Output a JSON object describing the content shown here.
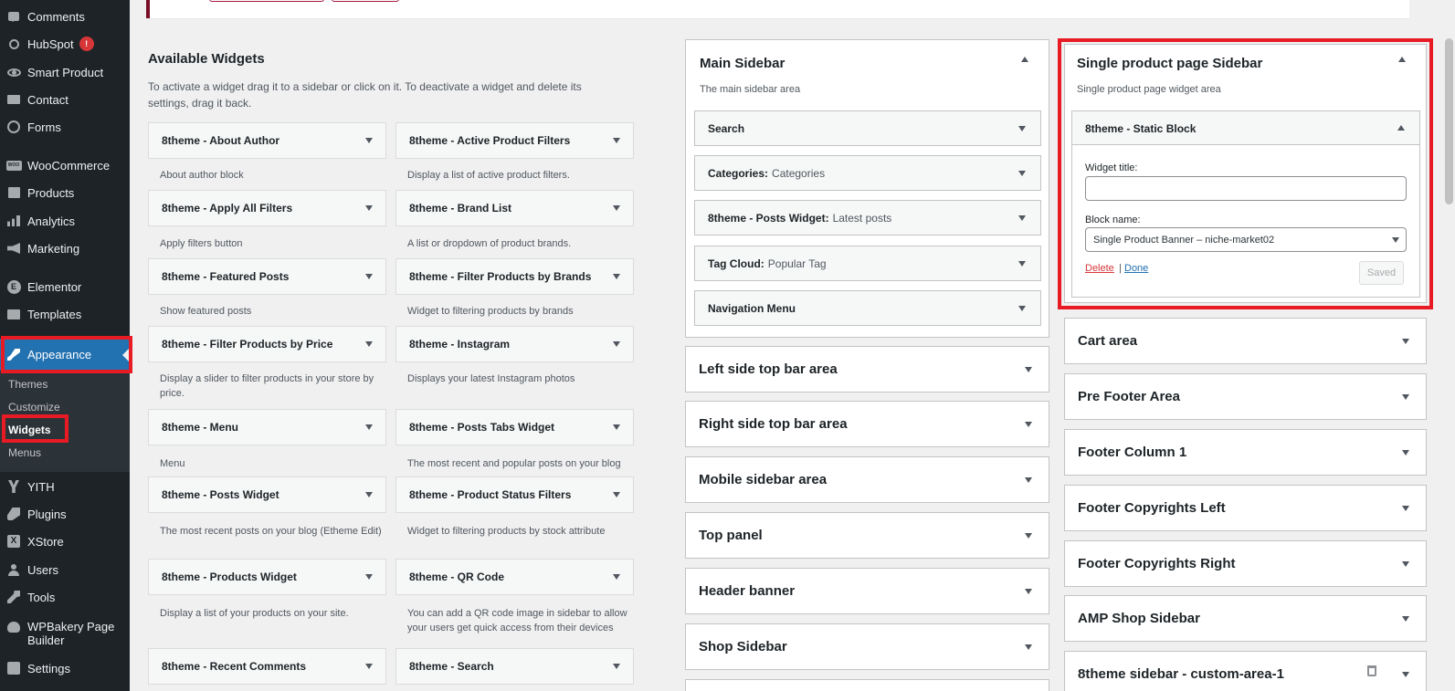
{
  "menu": {
    "items": [
      {
        "label": "Comments",
        "icon": "comments-icon"
      },
      {
        "label": "HubSpot",
        "icon": "hubspot-icon",
        "badge": "!"
      },
      {
        "label": "Smart Product",
        "icon": "eye-icon"
      },
      {
        "label": "Contact",
        "icon": "mail-icon"
      },
      {
        "label": "Forms",
        "icon": "forms-icon"
      },
      {
        "label": "WooCommerce",
        "icon": "woocommerce-icon",
        "icon_text": "WOO"
      },
      {
        "label": "Products",
        "icon": "box-icon"
      },
      {
        "label": "Analytics",
        "icon": "bar-chart-icon"
      },
      {
        "label": "Marketing",
        "icon": "megaphone-icon"
      },
      {
        "label": "Elementor",
        "icon": "elementor-icon",
        "icon_text": "E"
      },
      {
        "label": "Templates",
        "icon": "folder-icon"
      },
      {
        "label": "Appearance",
        "icon": "brush-icon"
      },
      {
        "label": "YITH",
        "icon": "yith-icon"
      },
      {
        "label": "Plugins",
        "icon": "plugin-icon"
      },
      {
        "label": "XStore",
        "icon": "xstore-icon",
        "icon_text": "X"
      },
      {
        "label": "Users",
        "icon": "user-icon"
      },
      {
        "label": "Tools",
        "icon": "wrench-icon"
      },
      {
        "label": "WPBakery Page Builder",
        "icon": "wpbakery-icon"
      },
      {
        "label": "Settings",
        "icon": "settings-icon"
      }
    ],
    "submenu": [
      "Themes",
      "Customize",
      "Widgets",
      "Menus"
    ]
  },
  "available": {
    "title": "Available Widgets",
    "description": "To activate a widget drag it to a sidebar or click on it. To deactivate a widget and delete its settings, drag it back.",
    "widgets": [
      {
        "name": "8theme - About Author",
        "desc": "About author block"
      },
      {
        "name": "8theme - Active Product Filters",
        "desc": "Display a list of active product filters."
      },
      {
        "name": "8theme - Apply All Filters",
        "desc": "Apply filters button"
      },
      {
        "name": "8theme - Brand List",
        "desc": "A list or dropdown of product brands."
      },
      {
        "name": "8theme - Featured Posts",
        "desc": "Show featured posts"
      },
      {
        "name": "8theme - Filter Products by Brands",
        "desc": "Widget to filtering products by brands"
      },
      {
        "name": "8theme - Filter Products by Price",
        "desc": "Display a slider to filter products in your store by price."
      },
      {
        "name": "8theme - Instagram",
        "desc": "Displays your latest Instagram photos"
      },
      {
        "name": "8theme - Menu",
        "desc": "Menu"
      },
      {
        "name": "8theme - Posts Tabs Widget",
        "desc": "The most recent and popular posts on your blog"
      },
      {
        "name": "8theme - Posts Widget",
        "desc": "The most recent posts on your blog (Etheme Edit)"
      },
      {
        "name": "8theme - Product Status Filters",
        "desc": "Widget to filtering products by stock attribute"
      },
      {
        "name": "8theme - Products Widget",
        "desc": "Display a list of your products on your site."
      },
      {
        "name": "8theme - QR Code",
        "desc": "You can add a QR code image in sidebar to allow your users get quick access from their devices"
      },
      {
        "name": "8theme - Recent Comments",
        "desc": ""
      },
      {
        "name": "8theme - Search",
        "desc": ""
      }
    ]
  },
  "main_sidebar": {
    "title": "Main Sidebar",
    "description": "The main sidebar area",
    "widgets": [
      {
        "name": "Search",
        "sub": ""
      },
      {
        "name": "Categories:",
        "sub": "Categories"
      },
      {
        "name": "8theme - Posts Widget:",
        "sub": "Latest posts"
      },
      {
        "name": "Tag Cloud:",
        "sub": "Popular Tag"
      },
      {
        "name": "Navigation Menu",
        "sub": ""
      }
    ]
  },
  "middle_areas": [
    "Left side top bar area",
    "Right side top bar area",
    "Mobile sidebar area",
    "Top panel",
    "Header banner",
    "Shop Sidebar"
  ],
  "single_product": {
    "title": "Single product page Sidebar",
    "description": "Single product page widget area",
    "widget_name": "8theme - Static Block",
    "widget_title_label": "Widget title:",
    "widget_title_value": "",
    "block_name_label": "Block name:",
    "block_name_value": "Single Product Banner – niche-market02",
    "delete_label": "Delete",
    "separator": "|",
    "done_label": "Done",
    "saved_label": "Saved"
  },
  "right_areas": [
    "Cart area",
    "Pre Footer Area",
    "Footer Column 1",
    "Footer Copyrights Left",
    "Footer Copyrights Right",
    "AMP Shop Sidebar",
    "8theme sidebar - custom-area-1"
  ]
}
